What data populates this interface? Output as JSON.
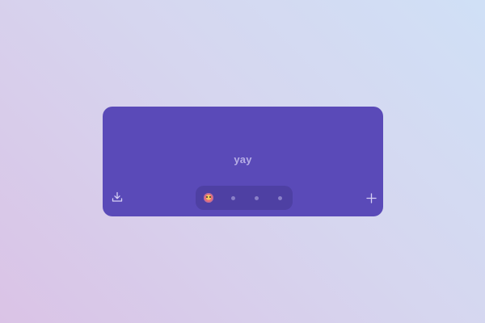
{
  "card": {
    "text": "yay",
    "background": "#5a4ab8"
  },
  "toolbar": {
    "download_icon": "download-icon",
    "add_icon": "plus-icon"
  },
  "pager": {
    "items": [
      {
        "icon": "emoji-face-icon",
        "active": true
      },
      {
        "icon": "dot-icon",
        "active": false
      },
      {
        "icon": "dot-icon",
        "active": false
      },
      {
        "icon": "dot-icon",
        "active": false
      }
    ]
  }
}
